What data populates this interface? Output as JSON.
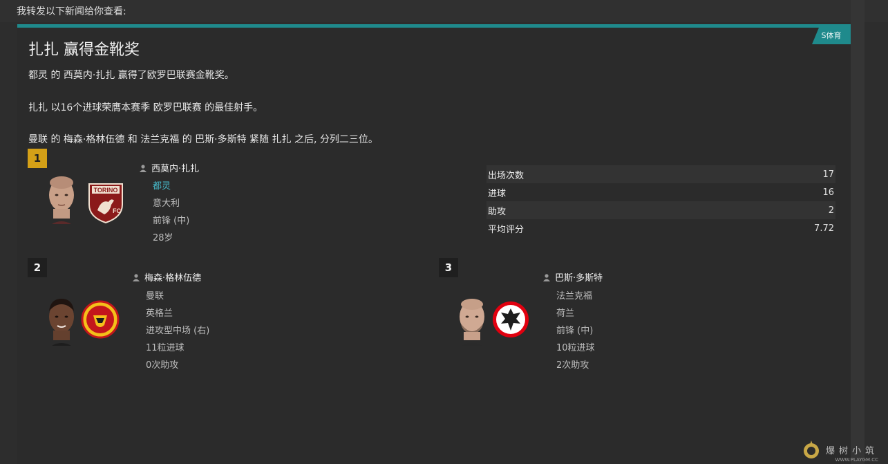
{
  "intro": "我转发以下新闻给你查看:",
  "source_tag": "S体育",
  "title": "扎扎 赢得金靴奖",
  "paragraphs": [
    "都灵 的 西莫内·扎扎 赢得了欧罗巴联赛金靴奖。",
    "扎扎 以16个进球荣膺本赛季 欧罗巴联赛 的最佳射手。",
    "曼联 的 梅森·格林伍德 和 法兰克福 的 巴斯·多斯特 紧随 扎扎 之后, 分列二三位。"
  ],
  "players": [
    {
      "rank": "1",
      "name": "西莫内·扎扎",
      "club": "都灵",
      "nation": "意大利",
      "position": "前锋 (中)",
      "extra": "28岁",
      "crest_text": "TORINO"
    },
    {
      "rank": "2",
      "name": "梅森·格林伍德",
      "club": "曼联",
      "nation": "英格兰",
      "position": "进攻型中场 (右)",
      "goals": "11粒进球",
      "assists": "0次助攻"
    },
    {
      "rank": "3",
      "name": "巴斯·多斯特",
      "club": "法兰克福",
      "nation": "荷兰",
      "position": "前锋 (中)",
      "goals": "10粒进球",
      "assists": "2次助攻"
    }
  ],
  "stats": [
    {
      "label": "出场次数",
      "value": "17"
    },
    {
      "label": "进球",
      "value": "16"
    },
    {
      "label": "助攻",
      "value": "2"
    },
    {
      "label": "平均评分",
      "value": "7.72"
    }
  ],
  "watermark": {
    "text": "爆树小筑",
    "sub": "WWW.PLAYGM.CC"
  },
  "colors": {
    "accent": "#1f8a8c",
    "gold": "#d4a017",
    "link": "#45b6c6"
  }
}
